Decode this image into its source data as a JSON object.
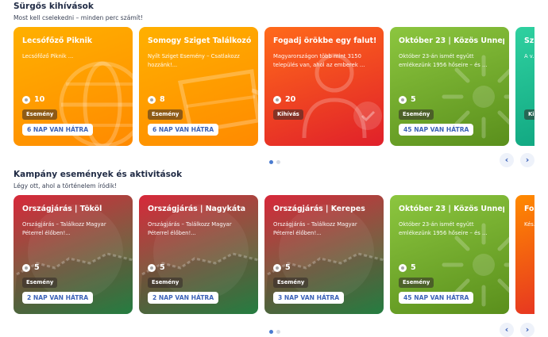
{
  "sections": [
    {
      "title": "Sürgős kihívások",
      "subtitle": "Most kell cselekedni – minden perc számít!",
      "cards": [
        {
          "title": "Lecsófőző Piknik",
          "desc": "Lecsófőző Piknik ...",
          "points": "10",
          "badge": "Esemény",
          "days": "6 NAP VAN HÁTRA",
          "color_top": "#ffb000",
          "color_bottom": "#ff8a00",
          "icon": "globe-illustration"
        },
        {
          "title": "Somogy Sziget Találkozó",
          "desc": "Nyílt Sziget Esemény – Csatlakozz hozzánk!...",
          "points": "8",
          "badge": "Esemény",
          "days": "6 NAP VAN HÁTRA",
          "color_top": "#ffb000",
          "color_bottom": "#ff8a00",
          "icon": "cup-illustration"
        },
        {
          "title": "Fogadj örökbe egy falut!",
          "desc": "Magyarországon több mint 3150 település van, ahol az emberek ...",
          "points": "20",
          "badge": "Kihívás",
          "days": "",
          "color_top": "#ff6a1a",
          "color_bottom": "#e0202a",
          "icon": "person-illustration"
        },
        {
          "title": "Október 23 | Közös Ünnep",
          "desc": "Október 23-án ismét együtt emlékezünk 1956 hőseire – és ...",
          "points": "5",
          "badge": "Esemény",
          "days": "45 NAP VAN HÁTRA",
          "color_top": "#8cc63f",
          "color_bottom": "#5a8f1c",
          "icon": "sunburst-illustration"
        },
        {
          "title": "Sz...",
          "desc": "A v... Hú...",
          "points": "",
          "badge": "Kih",
          "days": "",
          "color_top": "#2fd1a0",
          "color_bottom": "#0a9d7a",
          "icon": "sunburst-illustration"
        }
      ],
      "pagination": {
        "count": 2,
        "active": 0
      }
    },
    {
      "title": "Kampány események és aktivitások",
      "subtitle": "Légy ott, ahol a történelem íródik!",
      "cards": [
        {
          "title": "Országjárás | Tököl",
          "desc": "Országjárás – Találkozz Magyar Péterrel élőben!...",
          "points": "5",
          "badge": "Esemény",
          "days": "2 NAP VAN HÁTRA",
          "color_top": "#d8283a",
          "color_bottom": "#2a8f4a",
          "icon": "hungary-map-illustration"
        },
        {
          "title": "Országjárás | Nagykáta",
          "desc": "Országjárás – Találkozz Magyar Péterrel élőben!...",
          "points": "5",
          "badge": "Esemény",
          "days": "2 NAP VAN HÁTRA",
          "color_top": "#d8283a",
          "color_bottom": "#2a8f4a",
          "icon": "hungary-map-illustration"
        },
        {
          "title": "Országjárás | Kerepes",
          "desc": "Országjárás – Találkozz Magyar Péterrel élőben!...",
          "points": "5",
          "badge": "Esemény",
          "days": "3 NAP VAN HÁTRA",
          "color_top": "#d8283a",
          "color_bottom": "#2a8f4a",
          "icon": "hungary-map-illustration"
        },
        {
          "title": "Október 23 | Közös Ünnep",
          "desc": "Október 23-án ismét együtt emlékezünk 1956 hőseire – és ...",
          "points": "5",
          "badge": "Esemény",
          "days": "45 NAP VAN HÁTRA",
          "color_top": "#8cc63f",
          "color_bottom": "#5a8f1c",
          "icon": "sunburst-illustration"
        },
        {
          "title": "Fo...",
          "desc": "Kés... nap...",
          "points": "",
          "badge": "",
          "days": "",
          "color_top": "#ff8a00",
          "color_bottom": "#e0202a",
          "icon": "sunburst-illustration"
        }
      ],
      "pagination": {
        "count": 2,
        "active": 0
      }
    }
  ],
  "nav": {
    "prev": "‹",
    "next": "›"
  }
}
